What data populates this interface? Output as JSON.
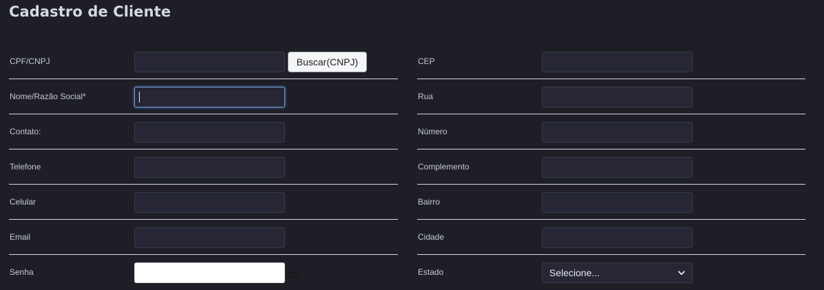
{
  "page": {
    "title": "Cadastro de Cliente"
  },
  "left_fields": [
    {
      "label": "CPF/CNPJ",
      "value": ""
    },
    {
      "label": "Nome/Razão Social*",
      "value": ""
    },
    {
      "label": "Contato:",
      "value": ""
    },
    {
      "label": "Telefone",
      "value": ""
    },
    {
      "label": "Celular",
      "value": ""
    },
    {
      "label": "Email",
      "value": ""
    },
    {
      "label": "Senha",
      "value": ""
    }
  ],
  "buscar_button": {
    "label": "Buscar(CNPJ)"
  },
  "right_fields": [
    {
      "label": "CEP",
      "value": ""
    },
    {
      "label": "Rua",
      "value": ""
    },
    {
      "label": "Número",
      "value": ""
    },
    {
      "label": "Complemento",
      "value": ""
    },
    {
      "label": "Bairro",
      "value": ""
    },
    {
      "label": "Cidade",
      "value": ""
    },
    {
      "label": "Estado",
      "value": "Selecione..."
    }
  ],
  "icons": {
    "password_toggle": "eye-icon",
    "select_arrow": "chevron-down-icon"
  },
  "colors": {
    "background": "#1e1e26",
    "input_bg": "#262634",
    "focus_ring": "#7aa0d6"
  }
}
